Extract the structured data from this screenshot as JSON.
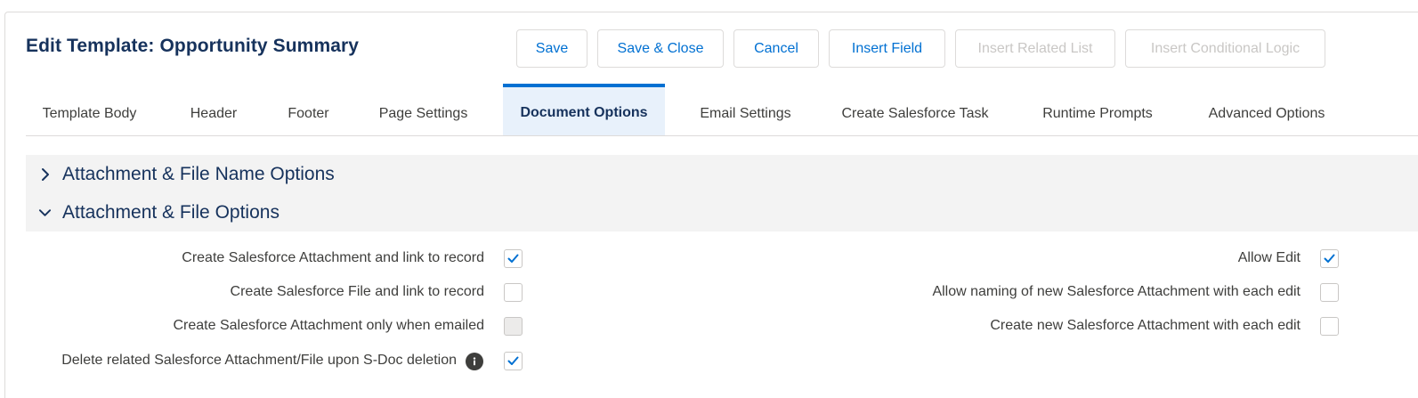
{
  "header": {
    "title": "Edit Template: Opportunity Summary"
  },
  "toolbar": {
    "save": "Save",
    "save_close": "Save & Close",
    "cancel": "Cancel",
    "insert_field": "Insert Field",
    "insert_related_list": "Insert Related List",
    "insert_conditional_logic": "Insert Conditional Logic"
  },
  "tabs": [
    "Template Body",
    "Header",
    "Footer",
    "Page Settings",
    "Document Options",
    "Email Settings",
    "Create Salesforce Task",
    "Runtime Prompts",
    "Advanced Options"
  ],
  "active_tab": "Document Options",
  "sections": {
    "name_options": {
      "label": "Attachment & File Name Options",
      "expanded": false
    },
    "file_options": {
      "label": "Attachment & File Options",
      "expanded": true
    }
  },
  "options_left": [
    {
      "label": "Create Salesforce Attachment and link to record",
      "checked": true,
      "disabled": false
    },
    {
      "label": "Create Salesforce File and link to record",
      "checked": false,
      "disabled": false
    },
    {
      "label": "Create Salesforce Attachment only when emailed",
      "checked": false,
      "disabled": true
    },
    {
      "label": "Delete related Salesforce Attachment/File upon S-Doc deletion",
      "checked": true,
      "disabled": false,
      "info_icon": "info-icon"
    }
  ],
  "options_right": [
    {
      "label": "Allow Edit",
      "checked": true,
      "disabled": false
    },
    {
      "label": "Allow naming of new Salesforce Attachment with each edit",
      "checked": false,
      "disabled": false
    },
    {
      "label": "Create new Salesforce Attachment with each edit",
      "checked": false,
      "disabled": false
    }
  ],
  "colors": {
    "brand": "#0070d2",
    "title": "#16325c",
    "section_bg": "#f3f3f3",
    "active_tab_bg": "#e8f1fb"
  }
}
